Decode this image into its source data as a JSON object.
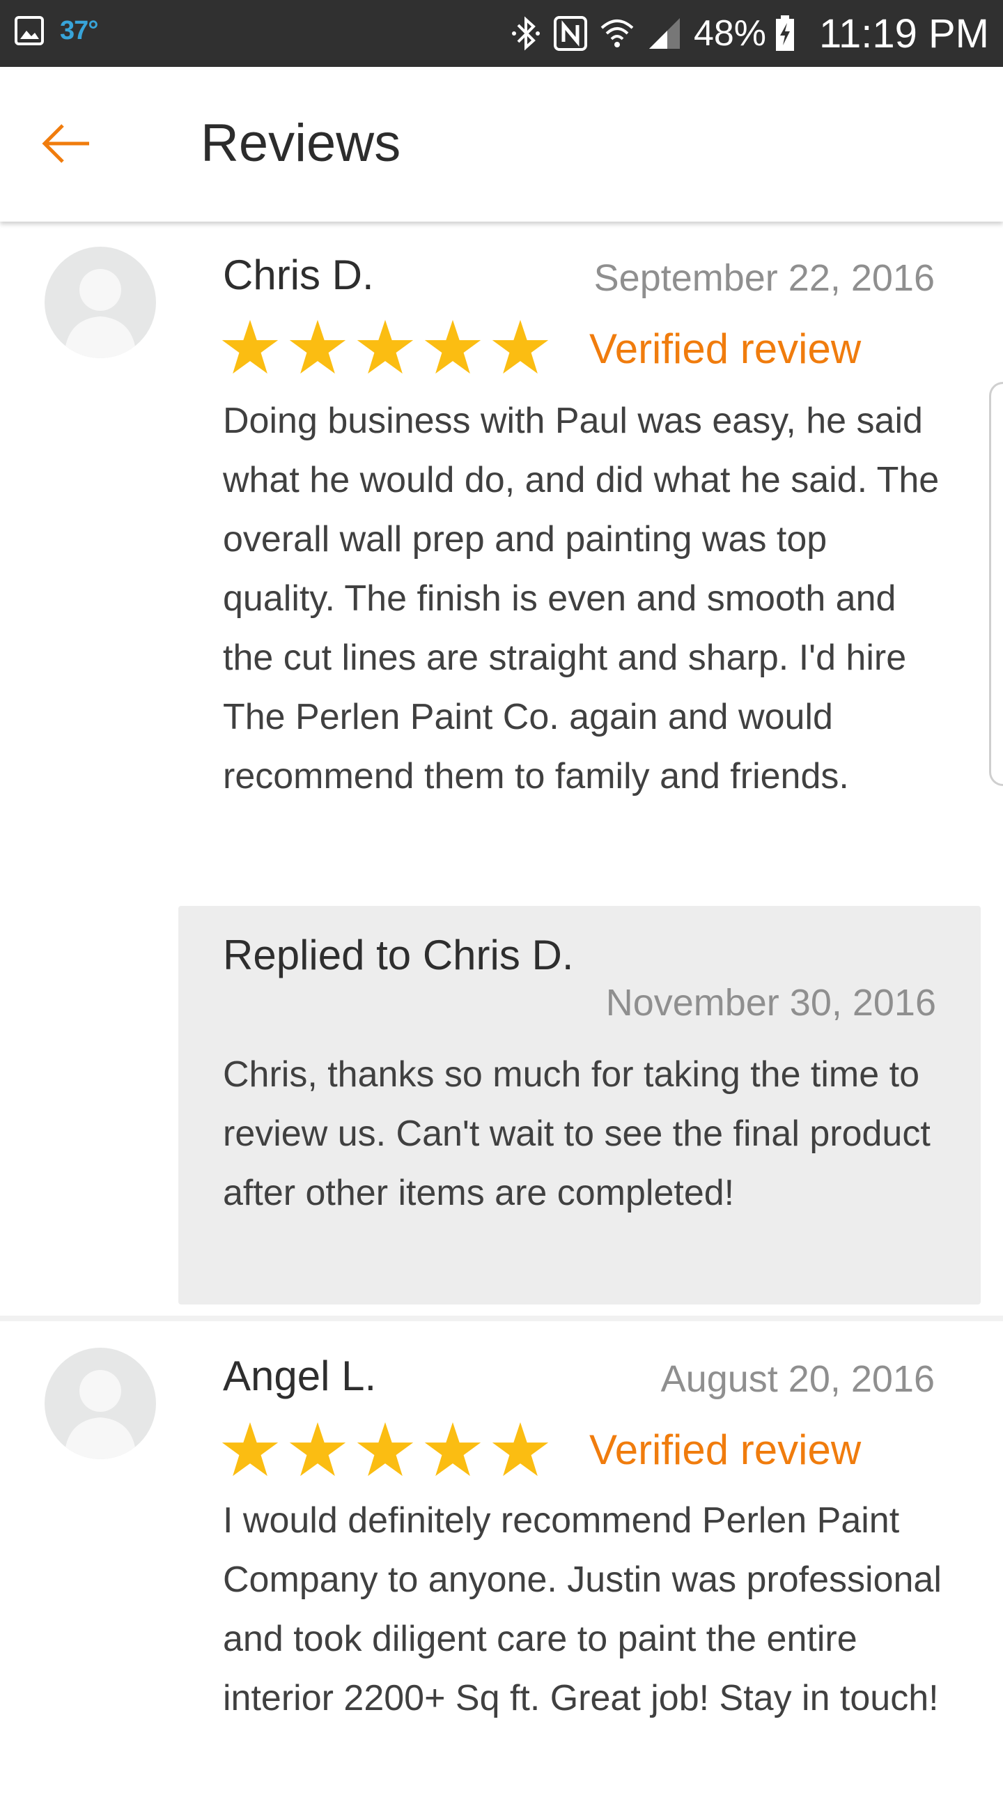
{
  "status_bar": {
    "temperature": "37°",
    "battery": "48%",
    "time": "11:19 PM",
    "icons": [
      "image-icon",
      "bluetooth-icon",
      "nfc-icon",
      "wifi-icon",
      "signal-icon",
      "battery-icon"
    ]
  },
  "header": {
    "title": "Reviews",
    "back_icon": "back-arrow-icon"
  },
  "colors": {
    "accent": "#f07c0d",
    "star": "#fbbd12",
    "status_bar_bg": "#303030",
    "reply_bg": "#ededed"
  },
  "reviews": [
    {
      "reviewer": "Chris D.",
      "date": "September 22, 2016",
      "rating": 5,
      "badge": "Verified review",
      "text": "Doing business with Paul was easy, he said what he would do, and did what he said. The overall wall prep and painting was top quality. The finish is even and smooth and the cut lines are straight and sharp. I'd hire The Perlen Paint Co. again and would recommend them to family and friends.",
      "reply": {
        "label": "Replied to Chris D.",
        "date": "November 30, 2016",
        "text": "Chris, thanks so much for taking the time to review us. Can't wait to see the final product after other items are completed!"
      }
    },
    {
      "reviewer": "Angel L.",
      "date": "August 20, 2016",
      "rating": 5,
      "badge": "Verified review",
      "text": "I would definitely recommend Perlen Paint Company to anyone. Justin was professional and took diligent care to paint the entire interior 2200+ Sq ft. Great job! Stay in touch!"
    }
  ]
}
